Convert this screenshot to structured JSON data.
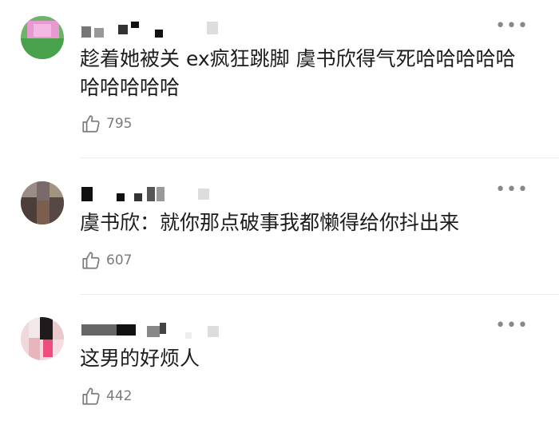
{
  "comments": [
    {
      "text": "趁着她被关 ex疯狂跳脚 虞书欣得气死哈哈哈哈哈哈哈哈哈哈",
      "likes": "795"
    },
    {
      "text": "虞书欣：就你那点破事我都懒得给你抖出来",
      "likes": "607"
    },
    {
      "text": "这男的好烦人",
      "likes": "442"
    }
  ],
  "icons": {
    "more": "more-horizontal-icon",
    "like": "thumbs-up-icon"
  }
}
